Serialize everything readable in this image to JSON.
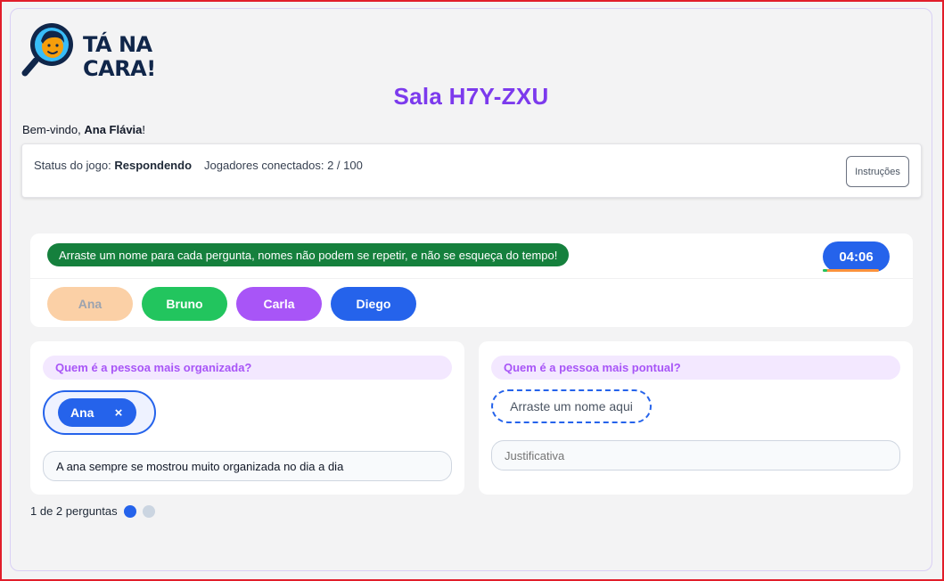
{
  "app": {
    "logo_text": "TÁ NA\nCARA!",
    "room_title": "Sala H7Y-ZXU"
  },
  "welcome": {
    "prefix": "Bem-vindo, ",
    "user_name": "Ana Flávia",
    "suffix": "!"
  },
  "status": {
    "game_status_label": "Status do jogo: ",
    "game_status_value": "Respondendo",
    "players_label": "Jogadores conectados: ",
    "players_value": "2 / 100",
    "instructions_button": "Instruções"
  },
  "names_panel": {
    "hint": "Arraste um nome para cada pergunta, nomes não podem se repetir, e não se esqueça do tempo!",
    "timer": "04:06",
    "timer_remaining_fraction": 0.08,
    "chips": [
      {
        "label": "Ana",
        "color": "#fbd0a6",
        "text_color": "#9ca3af",
        "used": true
      },
      {
        "label": "Bruno",
        "color": "#22c55e",
        "text_color": "#ffffff",
        "used": false
      },
      {
        "label": "Carla",
        "color": "#a855f7",
        "text_color": "#ffffff",
        "used": false
      },
      {
        "label": "Diego",
        "color": "#2563eb",
        "text_color": "#ffffff",
        "used": false
      }
    ]
  },
  "questions": [
    {
      "title": "Quem é a pessoa mais organizada?",
      "answer": "Ana",
      "remove_symbol": "×",
      "justification": "A ana sempre se mostrou muito organizada no dia a dia"
    },
    {
      "title": "Quem é a pessoa mais pontual?",
      "drop_placeholder": "Arraste um nome aqui",
      "justification_placeholder": "Justificativa"
    }
  ],
  "pager": {
    "label": "1 de 2 perguntas",
    "current": 1,
    "total": 2
  },
  "colors": {
    "accent_purple": "#7c3aed",
    "primary_blue": "#2563eb",
    "hint_green": "#15803d",
    "question_bg": "#f3e8ff"
  }
}
